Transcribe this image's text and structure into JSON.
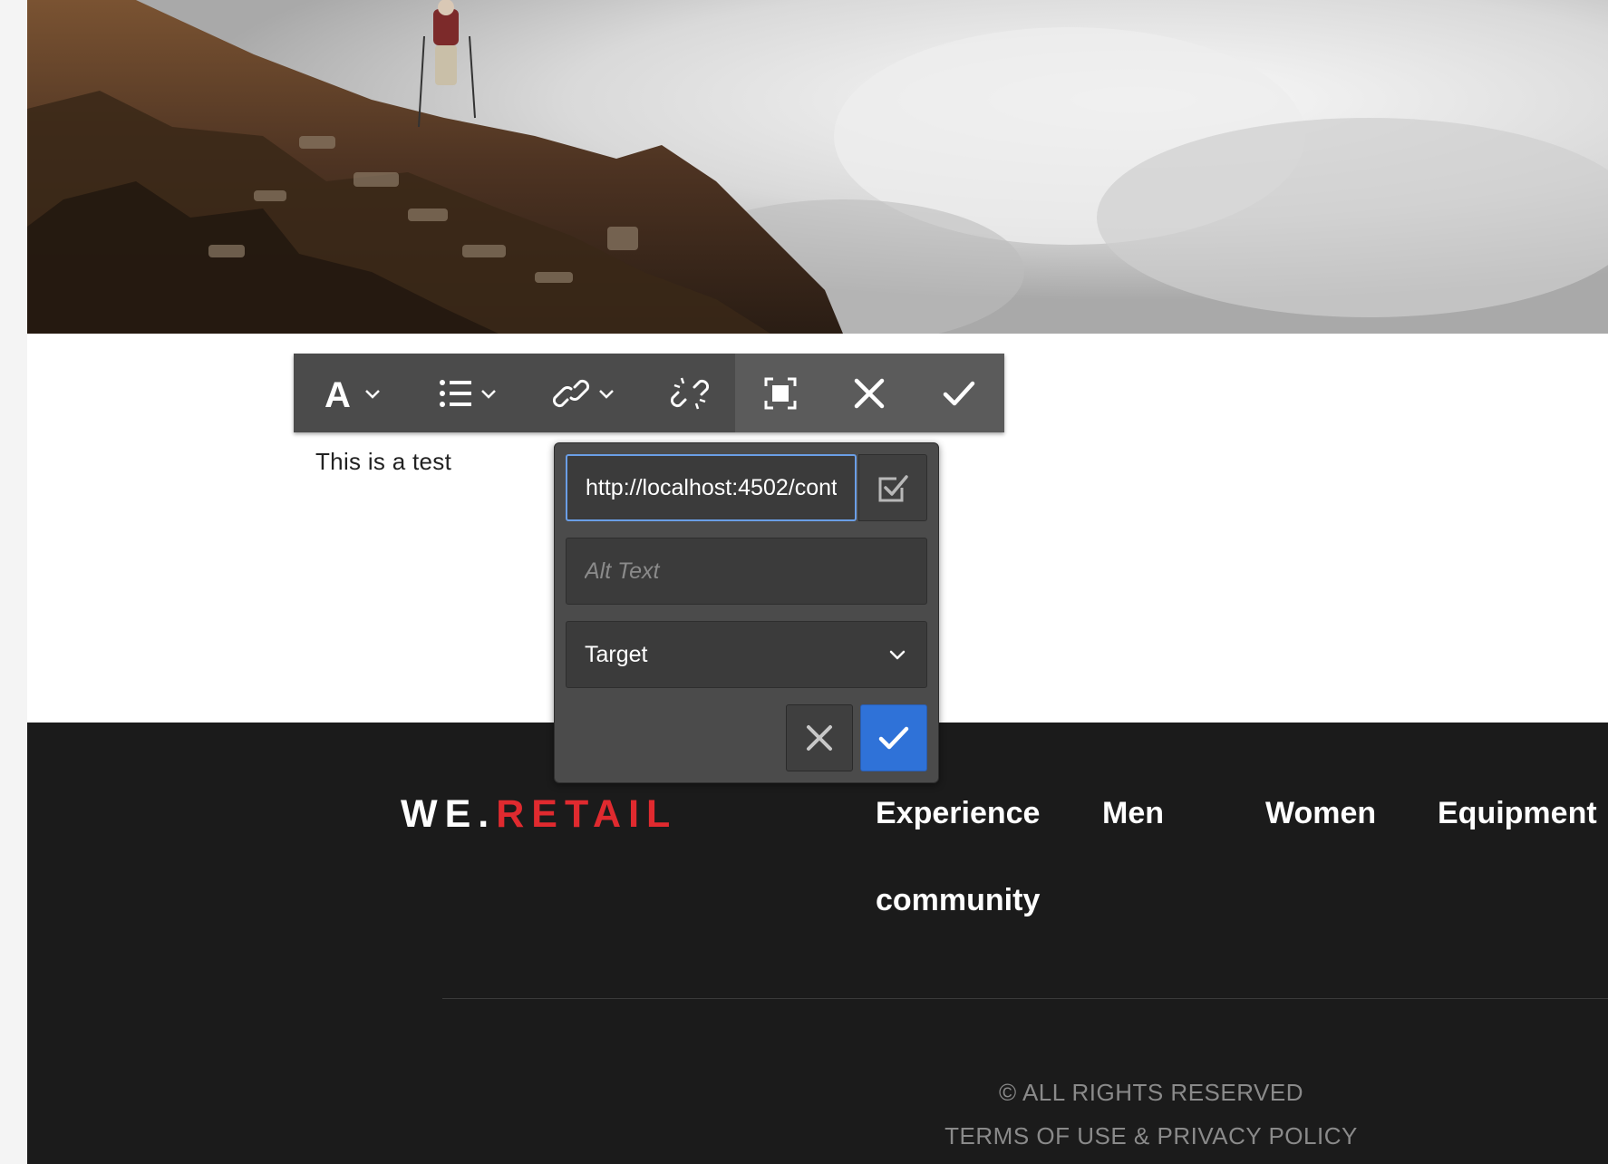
{
  "hero": {
    "image": "mountain-hiker-photo"
  },
  "toolbar": {
    "buttons": [
      {
        "name": "format-button",
        "icon": "text-format-icon",
        "dropdown": true
      },
      {
        "name": "list-button",
        "icon": "list-icon",
        "dropdown": true
      },
      {
        "name": "link-button",
        "icon": "link-icon",
        "dropdown": true
      },
      {
        "name": "unlink-button",
        "icon": "unlink-icon",
        "dropdown": false
      },
      {
        "name": "fullscreen-button",
        "icon": "fullscreen-icon",
        "dropdown": false
      },
      {
        "name": "cancel-button",
        "icon": "close-icon",
        "dropdown": false
      },
      {
        "name": "save-button",
        "icon": "checkmark-icon",
        "dropdown": false
      }
    ]
  },
  "content": {
    "text": "This is a test"
  },
  "link_dialog": {
    "url_value": "http://localhost:4502/cont",
    "alt_text_placeholder": "Alt Text",
    "target_label": "Target",
    "accent": "#2f72d8",
    "focus_color": "#6a9ee6"
  },
  "footer": {
    "logo_white": "WE.",
    "logo_red": "RETAIL",
    "logo_red_color": "#e02a2f",
    "nav": [
      "Experience",
      "Men",
      "Women",
      "Equipment",
      "community"
    ],
    "copyright": "© ALL RIGHTS RESERVED",
    "legal": "TERMS OF USE & PRIVACY POLICY"
  }
}
